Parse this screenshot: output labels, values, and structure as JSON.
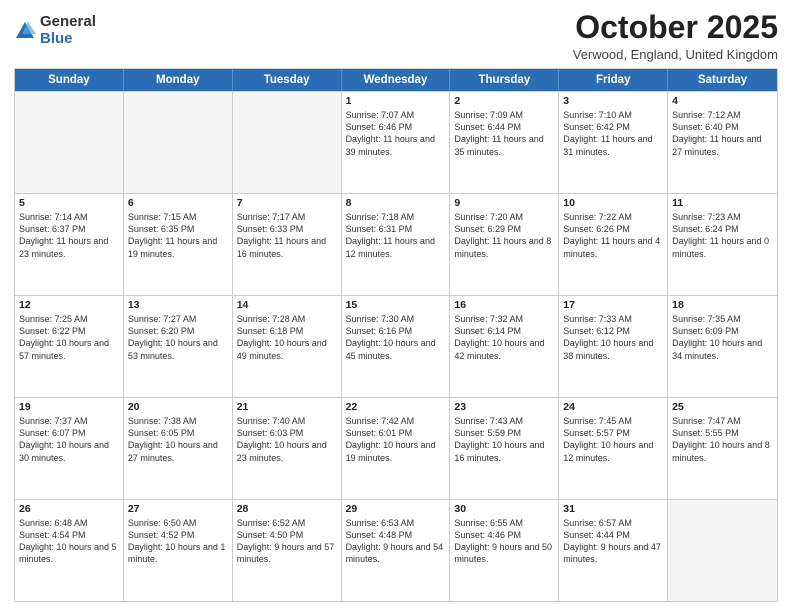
{
  "logo": {
    "general": "General",
    "blue": "Blue"
  },
  "header": {
    "title": "October 2025",
    "location": "Verwood, England, United Kingdom"
  },
  "days_of_week": [
    "Sunday",
    "Monday",
    "Tuesday",
    "Wednesday",
    "Thursday",
    "Friday",
    "Saturday"
  ],
  "weeks": [
    [
      {
        "day": "",
        "sunrise": "",
        "sunset": "",
        "daylight": ""
      },
      {
        "day": "",
        "sunrise": "",
        "sunset": "",
        "daylight": ""
      },
      {
        "day": "",
        "sunrise": "",
        "sunset": "",
        "daylight": ""
      },
      {
        "day": "1",
        "sunrise": "Sunrise: 7:07 AM",
        "sunset": "Sunset: 6:46 PM",
        "daylight": "Daylight: 11 hours and 39 minutes."
      },
      {
        "day": "2",
        "sunrise": "Sunrise: 7:09 AM",
        "sunset": "Sunset: 6:44 PM",
        "daylight": "Daylight: 11 hours and 35 minutes."
      },
      {
        "day": "3",
        "sunrise": "Sunrise: 7:10 AM",
        "sunset": "Sunset: 6:42 PM",
        "daylight": "Daylight: 11 hours and 31 minutes."
      },
      {
        "day": "4",
        "sunrise": "Sunrise: 7:12 AM",
        "sunset": "Sunset: 6:40 PM",
        "daylight": "Daylight: 11 hours and 27 minutes."
      }
    ],
    [
      {
        "day": "5",
        "sunrise": "Sunrise: 7:14 AM",
        "sunset": "Sunset: 6:37 PM",
        "daylight": "Daylight: 11 hours and 23 minutes."
      },
      {
        "day": "6",
        "sunrise": "Sunrise: 7:15 AM",
        "sunset": "Sunset: 6:35 PM",
        "daylight": "Daylight: 11 hours and 19 minutes."
      },
      {
        "day": "7",
        "sunrise": "Sunrise: 7:17 AM",
        "sunset": "Sunset: 6:33 PM",
        "daylight": "Daylight: 11 hours and 16 minutes."
      },
      {
        "day": "8",
        "sunrise": "Sunrise: 7:18 AM",
        "sunset": "Sunset: 6:31 PM",
        "daylight": "Daylight: 11 hours and 12 minutes."
      },
      {
        "day": "9",
        "sunrise": "Sunrise: 7:20 AM",
        "sunset": "Sunset: 6:29 PM",
        "daylight": "Daylight: 11 hours and 8 minutes."
      },
      {
        "day": "10",
        "sunrise": "Sunrise: 7:22 AM",
        "sunset": "Sunset: 6:26 PM",
        "daylight": "Daylight: 11 hours and 4 minutes."
      },
      {
        "day": "11",
        "sunrise": "Sunrise: 7:23 AM",
        "sunset": "Sunset: 6:24 PM",
        "daylight": "Daylight: 11 hours and 0 minutes."
      }
    ],
    [
      {
        "day": "12",
        "sunrise": "Sunrise: 7:25 AM",
        "sunset": "Sunset: 6:22 PM",
        "daylight": "Daylight: 10 hours and 57 minutes."
      },
      {
        "day": "13",
        "sunrise": "Sunrise: 7:27 AM",
        "sunset": "Sunset: 6:20 PM",
        "daylight": "Daylight: 10 hours and 53 minutes."
      },
      {
        "day": "14",
        "sunrise": "Sunrise: 7:28 AM",
        "sunset": "Sunset: 6:18 PM",
        "daylight": "Daylight: 10 hours and 49 minutes."
      },
      {
        "day": "15",
        "sunrise": "Sunrise: 7:30 AM",
        "sunset": "Sunset: 6:16 PM",
        "daylight": "Daylight: 10 hours and 45 minutes."
      },
      {
        "day": "16",
        "sunrise": "Sunrise: 7:32 AM",
        "sunset": "Sunset: 6:14 PM",
        "daylight": "Daylight: 10 hours and 42 minutes."
      },
      {
        "day": "17",
        "sunrise": "Sunrise: 7:33 AM",
        "sunset": "Sunset: 6:12 PM",
        "daylight": "Daylight: 10 hours and 38 minutes."
      },
      {
        "day": "18",
        "sunrise": "Sunrise: 7:35 AM",
        "sunset": "Sunset: 6:09 PM",
        "daylight": "Daylight: 10 hours and 34 minutes."
      }
    ],
    [
      {
        "day": "19",
        "sunrise": "Sunrise: 7:37 AM",
        "sunset": "Sunset: 6:07 PM",
        "daylight": "Daylight: 10 hours and 30 minutes."
      },
      {
        "day": "20",
        "sunrise": "Sunrise: 7:38 AM",
        "sunset": "Sunset: 6:05 PM",
        "daylight": "Daylight: 10 hours and 27 minutes."
      },
      {
        "day": "21",
        "sunrise": "Sunrise: 7:40 AM",
        "sunset": "Sunset: 6:03 PM",
        "daylight": "Daylight: 10 hours and 23 minutes."
      },
      {
        "day": "22",
        "sunrise": "Sunrise: 7:42 AM",
        "sunset": "Sunset: 6:01 PM",
        "daylight": "Daylight: 10 hours and 19 minutes."
      },
      {
        "day": "23",
        "sunrise": "Sunrise: 7:43 AM",
        "sunset": "Sunset: 5:59 PM",
        "daylight": "Daylight: 10 hours and 16 minutes."
      },
      {
        "day": "24",
        "sunrise": "Sunrise: 7:45 AM",
        "sunset": "Sunset: 5:57 PM",
        "daylight": "Daylight: 10 hours and 12 minutes."
      },
      {
        "day": "25",
        "sunrise": "Sunrise: 7:47 AM",
        "sunset": "Sunset: 5:55 PM",
        "daylight": "Daylight: 10 hours and 8 minutes."
      }
    ],
    [
      {
        "day": "26",
        "sunrise": "Sunrise: 6:48 AM",
        "sunset": "Sunset: 4:54 PM",
        "daylight": "Daylight: 10 hours and 5 minutes."
      },
      {
        "day": "27",
        "sunrise": "Sunrise: 6:50 AM",
        "sunset": "Sunset: 4:52 PM",
        "daylight": "Daylight: 10 hours and 1 minute."
      },
      {
        "day": "28",
        "sunrise": "Sunrise: 6:52 AM",
        "sunset": "Sunset: 4:50 PM",
        "daylight": "Daylight: 9 hours and 57 minutes."
      },
      {
        "day": "29",
        "sunrise": "Sunrise: 6:53 AM",
        "sunset": "Sunset: 4:48 PM",
        "daylight": "Daylight: 9 hours and 54 minutes."
      },
      {
        "day": "30",
        "sunrise": "Sunrise: 6:55 AM",
        "sunset": "Sunset: 4:46 PM",
        "daylight": "Daylight: 9 hours and 50 minutes."
      },
      {
        "day": "31",
        "sunrise": "Sunrise: 6:57 AM",
        "sunset": "Sunset: 4:44 PM",
        "daylight": "Daylight: 9 hours and 47 minutes."
      },
      {
        "day": "",
        "sunrise": "",
        "sunset": "",
        "daylight": ""
      }
    ]
  ]
}
